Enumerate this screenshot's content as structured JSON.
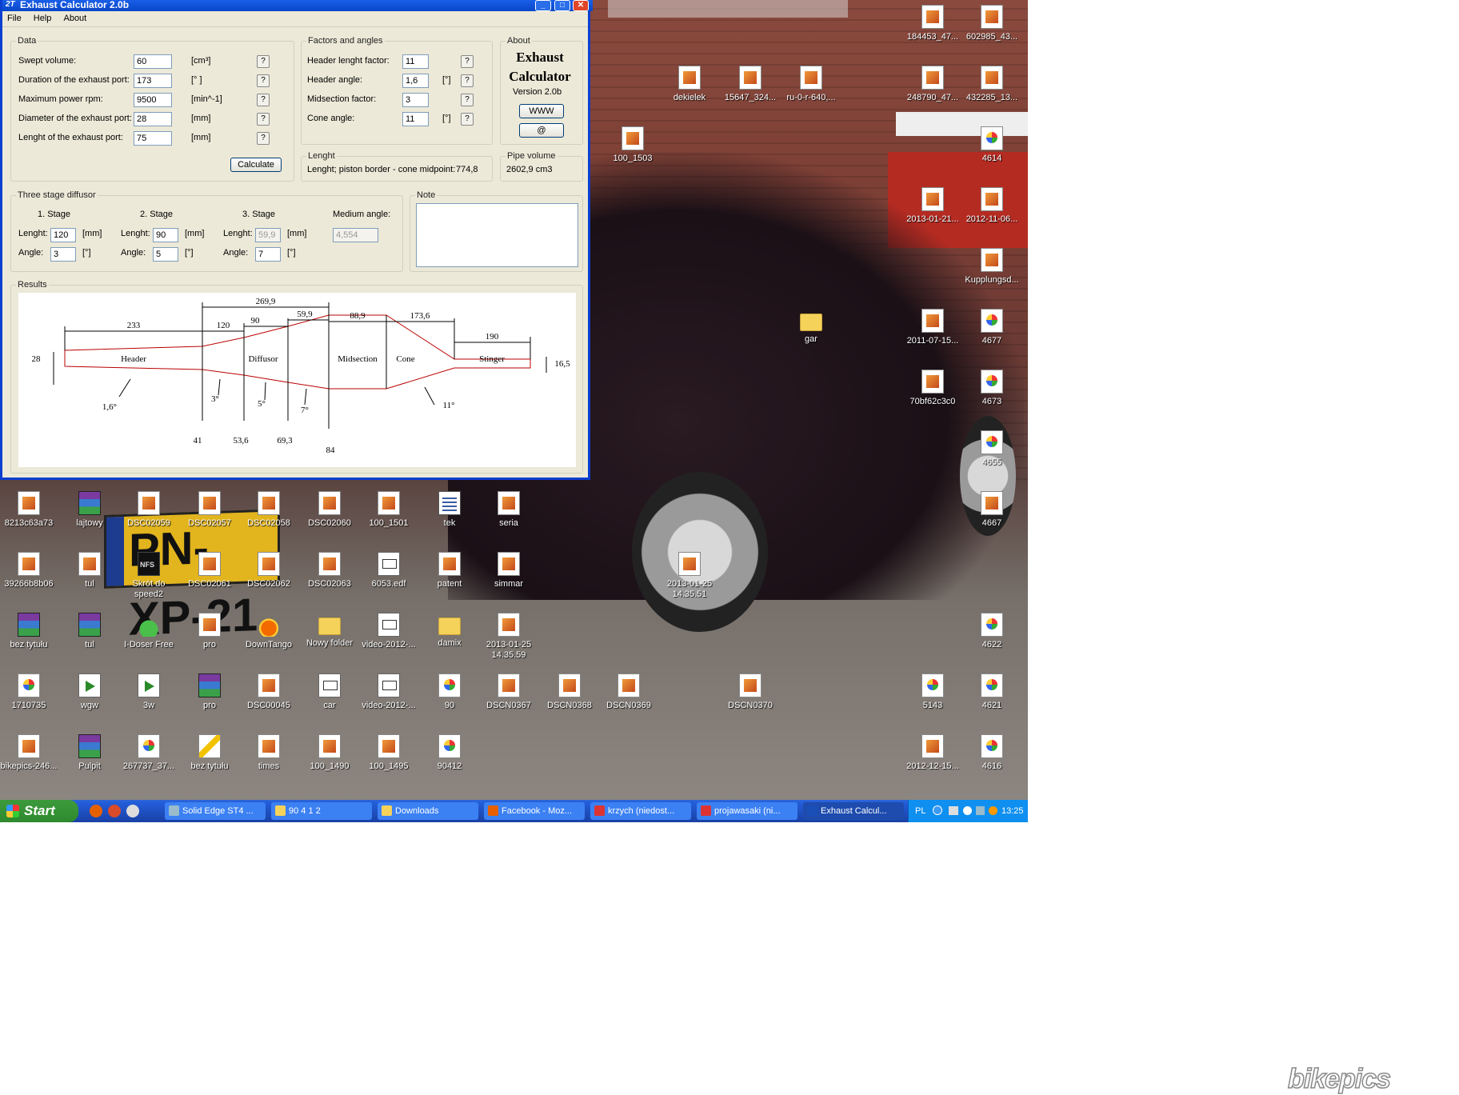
{
  "window": {
    "title": "Exhaust Calculator 2.0b",
    "icon": "2T",
    "menu": [
      "File",
      "Help",
      "About"
    ]
  },
  "data_group": {
    "title": "Data",
    "rows": [
      {
        "label": "Swept volume:",
        "value": "60",
        "unit": "[cm³]"
      },
      {
        "label": "Duration of the exhaust port:",
        "value": "173",
        "unit": "[° ]"
      },
      {
        "label": "Maximum power rpm:",
        "value": "9500",
        "unit": "[min^-1]"
      },
      {
        "label": "Diameter of the exhaust port:",
        "value": "28",
        "unit": "[mm]"
      },
      {
        "label": "Lenght of the exhaust port:",
        "value": "75",
        "unit": "[mm]"
      }
    ],
    "help": "?",
    "calculate": "Calculate"
  },
  "factors_group": {
    "title": "Factors and angles",
    "rows": [
      {
        "label": "Header lenght factor:",
        "value": "11",
        "unit": ""
      },
      {
        "label": "Header angle:",
        "value": "1,6",
        "unit": "[°]"
      },
      {
        "label": "Midsection factor:",
        "value": "3",
        "unit": ""
      },
      {
        "label": "Cone angle:",
        "value": "11",
        "unit": "[°]"
      }
    ]
  },
  "about_group": {
    "title": "About",
    "name_line1": "Exhaust",
    "name_line2": "Calculator",
    "version": "Version 2.0b",
    "www": "WWW",
    "at": "@"
  },
  "length_group": {
    "title": "Lenght",
    "text": "Lenght; piston border - cone midpoint:",
    "value": "774,8"
  },
  "pipe_group": {
    "title": "Pipe volume",
    "value": "2602,9 cm3"
  },
  "diffuser_group": {
    "title": "Three stage diffusor",
    "stages": [
      {
        "title": "1. Stage",
        "length": "120",
        "angle": "3"
      },
      {
        "title": "2. Stage",
        "length": "90",
        "angle": "5"
      },
      {
        "title": "3. Stage",
        "length": "59,9",
        "angle": "7"
      }
    ],
    "length_label": "Lenght:",
    "angle_label": "Angle:",
    "mm": "[mm]",
    "deg": "[°]",
    "medium_label": "Medium angle:",
    "medium_value": "4,554"
  },
  "note_group": {
    "title": "Note",
    "text": ""
  },
  "results_group": {
    "title": "Results",
    "dims_top": [
      "269,9",
      "233",
      "120",
      "90",
      "59,9",
      "88,9",
      "173,6",
      "190"
    ],
    "sections": [
      "Header",
      "Diffusor",
      "Midsection",
      "Cone",
      "Stinger"
    ],
    "left_dia": "28",
    "right_dia": "16,5",
    "angles": [
      "1,6°",
      "3°",
      "5°",
      "7°",
      "11°"
    ],
    "diameters": [
      "41",
      "53,6",
      "69,3",
      "84"
    ]
  },
  "desktop_icons": [
    {
      "label": "184453_47...",
      "type": "pic"
    },
    {
      "label": "602985_43...",
      "type": "pic"
    },
    {
      "label": "dekielek",
      "type": "pic"
    },
    {
      "label": "15647_324...",
      "type": "pic"
    },
    {
      "label": "ru-0-r-640,...",
      "type": "pic"
    },
    {
      "label": "248790_47...",
      "type": "pic"
    },
    {
      "label": "432285_13...",
      "type": "pic"
    },
    {
      "label": "100_1503",
      "type": "pic"
    },
    {
      "label": "4614",
      "type": "paint"
    },
    {
      "label": "2013-01-21...",
      "type": "pic"
    },
    {
      "label": "2012-11-06...",
      "type": "pic"
    },
    {
      "label": "Kupplungsd...",
      "type": "pic"
    },
    {
      "label": "gar",
      "type": "folder"
    },
    {
      "label": "2011-07-15...",
      "type": "pic"
    },
    {
      "label": "4677",
      "type": "paint"
    },
    {
      "label": "70bf62c3c0",
      "type": "pic"
    },
    {
      "label": "4673",
      "type": "paint"
    },
    {
      "label": "4655",
      "type": "paint"
    },
    {
      "label": "4667",
      "type": "pic"
    },
    {
      "label": "8213c63a73",
      "type": "pic"
    },
    {
      "label": "lajtowy",
      "type": "rar"
    },
    {
      "label": "DSC02059",
      "type": "pic"
    },
    {
      "label": "DSC02057",
      "type": "pic"
    },
    {
      "label": "DSC02058",
      "type": "pic"
    },
    {
      "label": "DSC02060",
      "type": "pic"
    },
    {
      "label": "100_1501",
      "type": "pic"
    },
    {
      "label": "tek",
      "type": "sheet"
    },
    {
      "label": "seria",
      "type": "pic"
    },
    {
      "label": "39266b8b06",
      "type": "pic"
    },
    {
      "label": "tul",
      "type": "pic"
    },
    {
      "label": "Skrót do speed2",
      "type": "nfs"
    },
    {
      "label": "DSC02061",
      "type": "pic"
    },
    {
      "label": "DSC02062",
      "type": "pic"
    },
    {
      "label": "DSC02063",
      "type": "pic"
    },
    {
      "label": "6053.edf",
      "type": "doc"
    },
    {
      "label": "patent",
      "type": "pic"
    },
    {
      "label": "simmar",
      "type": "pic"
    },
    {
      "label": "2013-01-25 14.35.51",
      "type": "pic"
    },
    {
      "label": "bez tytułu",
      "type": "rar"
    },
    {
      "label": "tul",
      "type": "rar"
    },
    {
      "label": "I-Doser Free",
      "type": "flask"
    },
    {
      "label": "pro",
      "type": "pic"
    },
    {
      "label": "DownTango",
      "type": "flame"
    },
    {
      "label": "Nowy folder",
      "type": "folder"
    },
    {
      "label": "video-2012-...",
      "type": "doc"
    },
    {
      "label": "damix",
      "type": "folder"
    },
    {
      "label": "2013-01-25 14.35.59",
      "type": "pic"
    },
    {
      "label": "4622",
      "type": "paint"
    },
    {
      "label": "1710735",
      "type": "paint"
    },
    {
      "label": "wgw",
      "type": "vid"
    },
    {
      "label": "3w",
      "type": "vid"
    },
    {
      "label": "pro",
      "type": "rar"
    },
    {
      "label": "DSC00045",
      "type": "pic"
    },
    {
      "label": "car",
      "type": "doc"
    },
    {
      "label": "video-2012-...",
      "type": "doc"
    },
    {
      "label": "90",
      "type": "paint"
    },
    {
      "label": "DSCN0367",
      "type": "pic"
    },
    {
      "label": "DSCN0368",
      "type": "pic"
    },
    {
      "label": "DSCN0369",
      "type": "pic"
    },
    {
      "label": "DSCN0370",
      "type": "pic"
    },
    {
      "label": "5143",
      "type": "paint"
    },
    {
      "label": "4621",
      "type": "paint"
    },
    {
      "label": "bikepics-246...",
      "type": "pic"
    },
    {
      "label": "Pulpit",
      "type": "rar"
    },
    {
      "label": "267737_37...",
      "type": "paint"
    },
    {
      "label": "bez tytułu",
      "type": "pencil"
    },
    {
      "label": "times",
      "type": "pic"
    },
    {
      "label": "100_1490",
      "type": "pic"
    },
    {
      "label": "100_1495",
      "type": "pic"
    },
    {
      "label": "90412",
      "type": "paint"
    },
    {
      "label": "2012-12-15...",
      "type": "pic"
    },
    {
      "label": "4616",
      "type": "paint"
    }
  ],
  "taskbar": {
    "start": "Start",
    "tasks": [
      "Solid Edge ST4 ...",
      "90 4 1 2",
      "Downloads",
      "Facebook - Moz...",
      "krzych (niedost...",
      "projawasaki (ni...",
      "Exhaust Calcul..."
    ],
    "lang": "PL",
    "clock": "13:25"
  },
  "wallpaper": {
    "plate": "PN-XP-21"
  },
  "watermark": "bikepics"
}
